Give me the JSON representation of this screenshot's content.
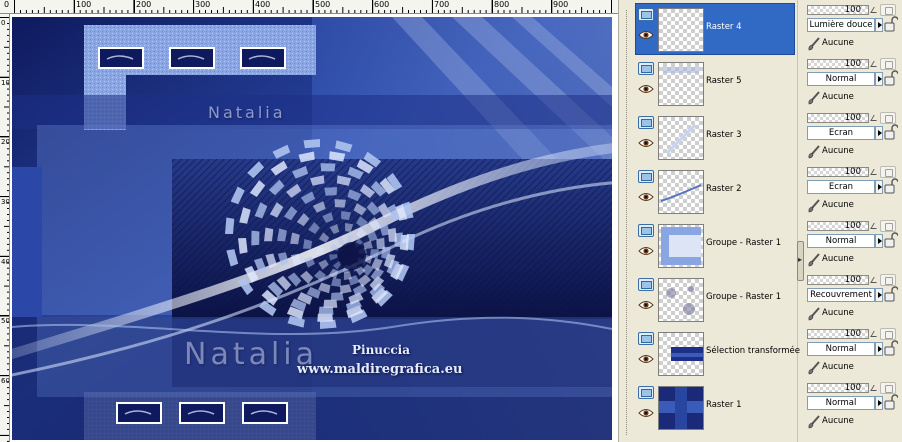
{
  "canvas": {
    "ruler_top_labels": [
      "0",
      "100",
      "200",
      "300",
      "400",
      "500",
      "600",
      "700",
      "800",
      "900"
    ],
    "ruler_left_labels": [
      "0",
      "100",
      "200",
      "300",
      "400",
      "500",
      "600"
    ],
    "artwork": {
      "watermark_top": "Natalia",
      "signature_script": "Natalia",
      "signature_author": "Pinuccia",
      "signature_url": "www.maldiregrafica.eu",
      "colors": {
        "dark_navy": "#10195a",
        "mid_blue": "#3a5cb8",
        "light_blue": "#a9c0ee",
        "pale_blue": "#cfdcf7"
      }
    }
  },
  "layers": [
    {
      "name": "Raster 4",
      "opacity": "100",
      "blend": "Lumière douce",
      "group": "Aucune",
      "selected": true
    },
    {
      "name": "Raster 5",
      "opacity": "100",
      "blend": "Normal",
      "group": "Aucune",
      "selected": false
    },
    {
      "name": "Raster 3",
      "opacity": "100",
      "blend": "Écran",
      "group": "Aucune",
      "selected": false
    },
    {
      "name": "Raster 2",
      "opacity": "100",
      "blend": "Écran",
      "group": "Aucune",
      "selected": false
    },
    {
      "name": "Groupe - Raster 1",
      "opacity": "100",
      "blend": "Normal",
      "group": "Aucune",
      "selected": false
    },
    {
      "name": "Groupe - Raster 1",
      "opacity": "100",
      "blend": "Recouvrement",
      "group": "Aucune",
      "selected": false
    },
    {
      "name": "Sélection transformée",
      "opacity": "100",
      "blend": "Normal",
      "group": "Aucune",
      "selected": false
    },
    {
      "name": "Raster 1",
      "opacity": "100",
      "blend": "Normal",
      "group": "Aucune",
      "selected": false
    }
  ],
  "icons": {
    "layer_type": "raster-layer-icon",
    "visibility": "eye-icon",
    "mask": "mask-icon",
    "lock": "lock-icon",
    "group": "brush-icon"
  },
  "accent_color": "#316ac5"
}
